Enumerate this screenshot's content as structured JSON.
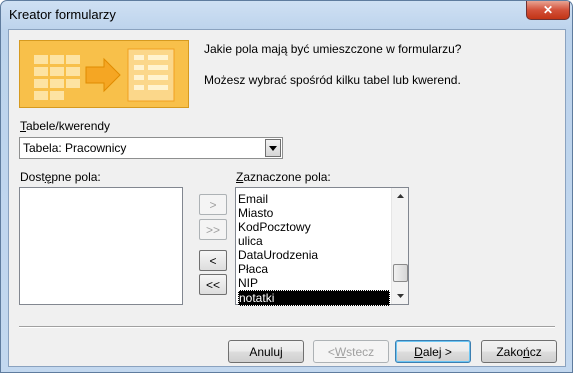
{
  "window": {
    "title": "Kreator formularzy",
    "close_glyph": "✕"
  },
  "header": {
    "prompt_line1": "Jakie pola mają być umieszczone w formularzu?",
    "prompt_line2": "Możesz wybrać spośród kilku tabel lub kwerend."
  },
  "tables": {
    "label_pre": "",
    "label_acc": "T",
    "label_post": "abele/kwerendy",
    "selected": "Tabela: Pracownicy",
    "dropdown_icon": "chevron-down-icon"
  },
  "available": {
    "label_pre": "Dost",
    "label_acc": "ę",
    "label_post": "pne pola:",
    "items": []
  },
  "selected_fields": {
    "label_pre": "",
    "label_acc": "Z",
    "label_post": "aznaczone pola:",
    "items": [
      "Email",
      "Miasto",
      "KodPocztowy",
      "ulica",
      "DataUrodzenia",
      "Płaca",
      "NIP",
      "notatki"
    ],
    "selected_item": "notatki"
  },
  "shuttle": {
    "add_one": ">",
    "add_all": ">>",
    "remove_one": "<",
    "remove_all": "<<"
  },
  "buttons": {
    "cancel": "Anuluj",
    "back_pre": "< ",
    "back_acc": "W",
    "back_post": "stecz",
    "next_pre": "",
    "next_acc": "D",
    "next_post": "alej >",
    "finish_pre": "Zako",
    "finish_acc": "ń",
    "finish_post": "cz"
  }
}
